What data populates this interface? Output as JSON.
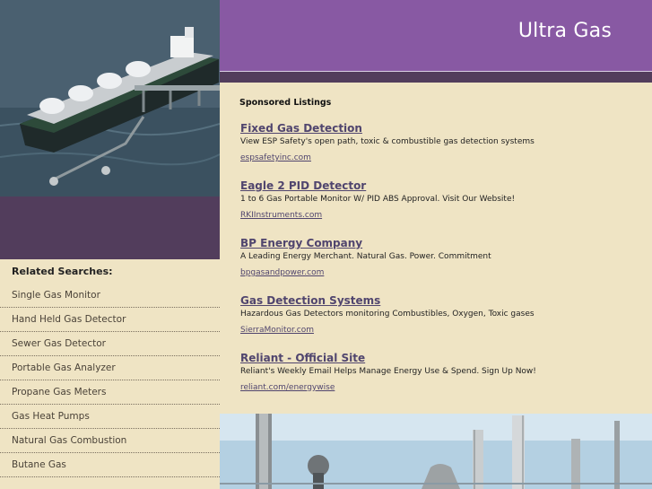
{
  "site": {
    "title": "Ultra Gas"
  },
  "sponsored": {
    "heading": "Sponsored Listings",
    "listings": [
      {
        "title": "Fixed Gas Detection",
        "description": "View ESP Safety's open path, toxic & combustible gas detection systems",
        "url": "espsafetyinc.com"
      },
      {
        "title": "Eagle 2 PID Detector",
        "description": "1 to 6 Gas Portable Monitor W/ PID ABS Approval. Visit Our Website!",
        "url": "RKIInstruments.com"
      },
      {
        "title": "BP Energy Company",
        "description": "A Leading Energy Merchant. Natural Gas. Power. Commitment",
        "url": "bpgasandpower.com"
      },
      {
        "title": "Gas Detection Systems",
        "description": "Hazardous Gas Detectors monitoring Combustibles, Oxygen, Toxic gases",
        "url": "SierraMonitor.com"
      },
      {
        "title": "Reliant - Official Site",
        "description": "Reliant's Weekly Email Helps Manage Energy Use & Spend. Sign Up Now!",
        "url": "reliant.com/energywise"
      }
    ]
  },
  "related": {
    "heading": "Related Searches:",
    "items": [
      "Single Gas Monitor",
      "Hand Held Gas Detector",
      "Sewer Gas Detector",
      "Portable Gas Analyzer",
      "Propane Gas Meters",
      "Gas Heat Pumps",
      "Natural Gas Combustion",
      "Butane Gas"
    ]
  },
  "images": {
    "hero": "lng-tanker-ship-photo",
    "bottom": "gas-plant-towers-photo"
  },
  "colors": {
    "header_purple": "#8859a3",
    "dark_band": "#523d5c",
    "content_bg": "#efe4c4",
    "link": "#50456e"
  }
}
